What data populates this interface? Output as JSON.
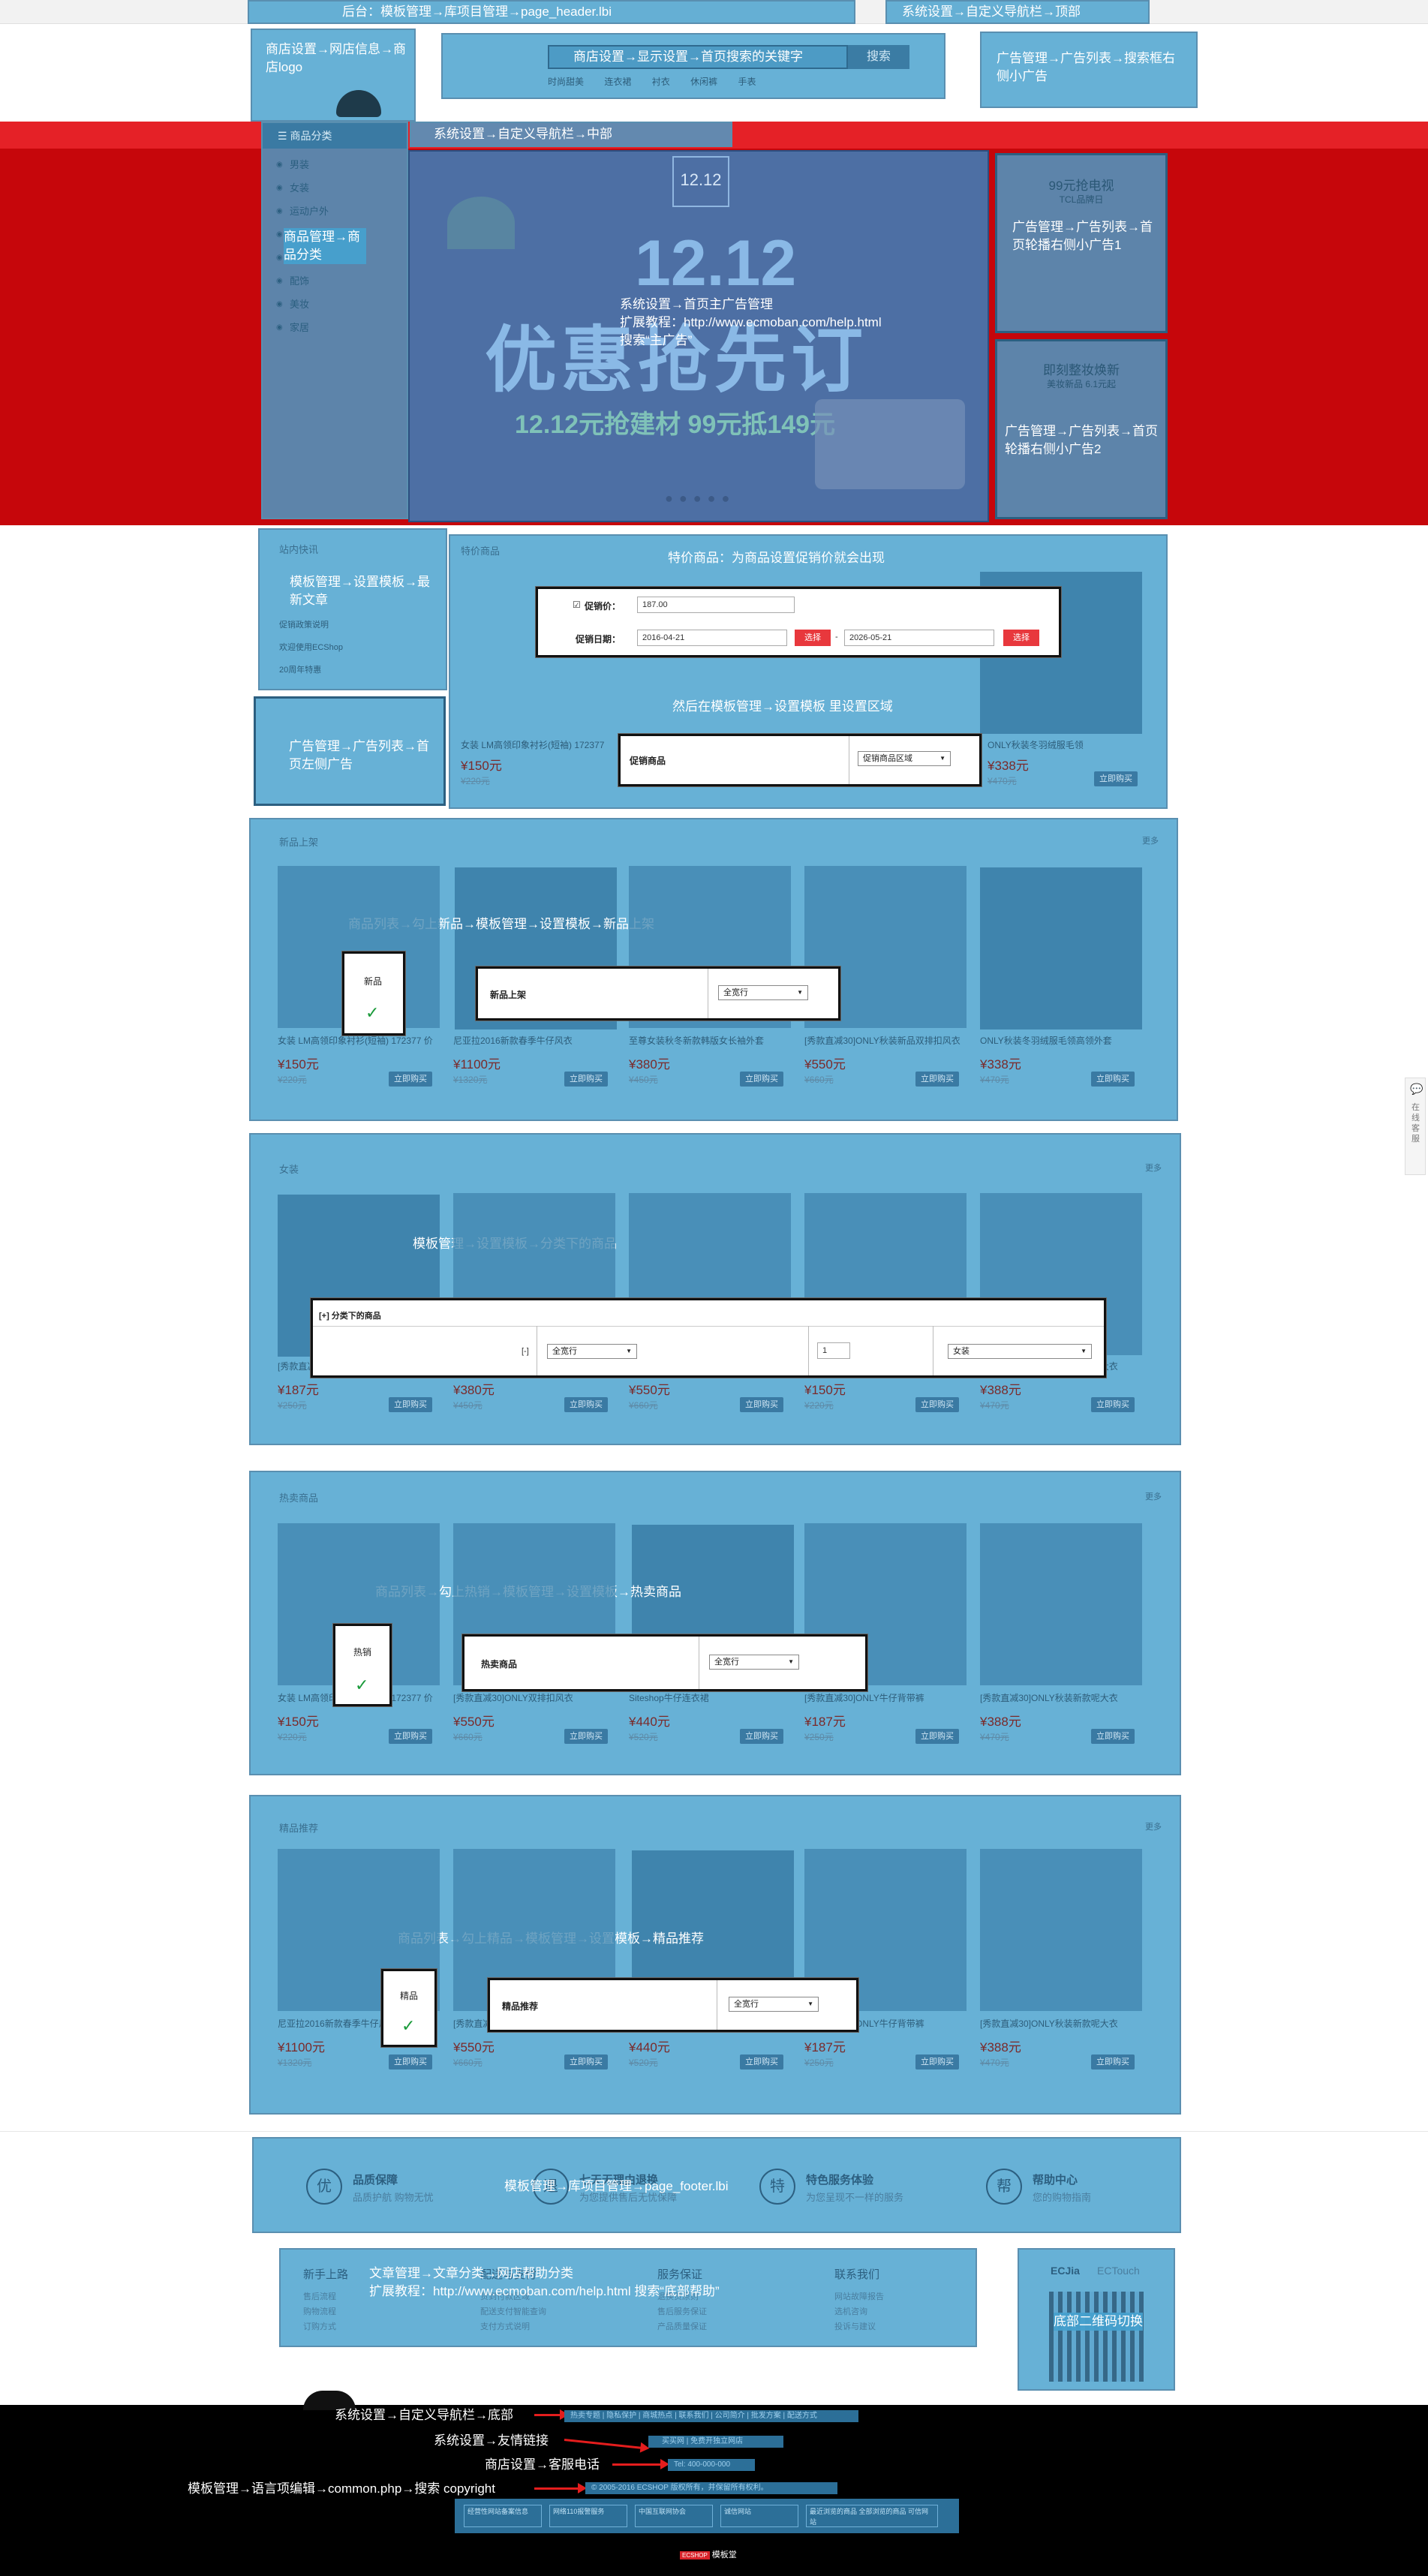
{
  "header": {
    "topbar_label": "后台：模板管理→库项目管理→page_header.lbi",
    "top_nav_label": "系统设置→自定义导航栏→顶部",
    "logo_label": "商店设置→网店信息→商店logo",
    "search_label": "商店设置→显示设置→首页搜索的关键字",
    "search_button": "搜索",
    "hot_keywords": [
      "时尚甜美",
      "连衣裙",
      "衬衣",
      "休闲裤",
      "手表"
    ],
    "search_ad_label": "广告管理→广告列表→搜索框右侧小广告",
    "middle_nav_label": "系统设置→自定义导航栏→中部"
  },
  "category": {
    "title": "商品分类",
    "items": [
      "男装",
      "女装",
      "运动户外",
      "",
      "箱包",
      "配饰",
      "美妆",
      "家居"
    ],
    "overlay_label": "商品管理→商品分类"
  },
  "main_banner": {
    "headline": "12.12",
    "big_text": "优惠抢先订",
    "sub_text": "12.12元抢建材 99元抵149元",
    "label_line1": "系统设置→首页主广告管理",
    "label_line2": "扩展教程：http://www.ecmoban.com/help.html",
    "label_line3": "搜索“主广告”"
  },
  "side_ads": {
    "ad1_title": "99元抢电视",
    "ad1_sub": "TCL品牌日",
    "ad1_label": "广告管理→广告列表→首页轮播右侧小广告1",
    "ad2_title": "即刻整妆焕新",
    "ad2_sub": "美妆新品 6.1元起",
    "ad2_label": "广告管理→广告列表→首页轮播右侧小广告2"
  },
  "news": {
    "title": "站内快讯",
    "overlay_label": "模板管理→设置模板→最新文章",
    "items": [
      "促销政策说明",
      "欢迎使用ECShop",
      "20周年特惠"
    ]
  },
  "left_ad_label": "广告管理→广告列表→首页左侧广告",
  "promo": {
    "title": "特价商品",
    "overlay_label": "特价商品：为商品设置促销价就会出现",
    "overlay_label2": "然后在模板管理→设置模板 里设置区域",
    "dialog_price_label": "促销价：",
    "dialog_price_value": "187.00",
    "dialog_date_label": "促销日期：",
    "dialog_date_start": "2016-04-21",
    "dialog_date_end": "2026-05-21",
    "dialog_pick": "选择",
    "dialog_region_label": "促销商品",
    "dialog_region_value": "促销商品区域",
    "products": [
      {
        "name": "女装 LM高领印象衬衫(短袖) 172377",
        "price": "¥150元",
        "old": "¥220元"
      },
      {
        "name": "ONLY秋装冬羽绒服毛领",
        "price": "¥338元",
        "old": "¥470元"
      }
    ]
  },
  "new_section": {
    "title": "新品上架",
    "more": "更多",
    "overlay_label": "商品列表→勾上新品→模板管理→设置模板→新品上架",
    "check_label": "新品",
    "dialog_label": "新品上架",
    "dialog_value": "全宽行",
    "products": [
      {
        "name": "女装 LM高领印象衬衫(短袖) 172377 价",
        "price": "¥150元",
        "old": "¥220元"
      },
      {
        "name": "尼亚拉2016新款春季牛仔风衣",
        "price": "¥1100元",
        "old": "¥1320元"
      },
      {
        "name": "至尊女装秋冬新款韩版女长袖外套",
        "price": "¥380元",
        "old": "¥450元"
      },
      {
        "name": "[秀款直减30]ONLY秋装新品双排扣风衣",
        "price": "¥550元",
        "old": "¥660元"
      },
      {
        "name": "ONLY秋装冬羽绒服毛领高领外套",
        "price": "¥338元",
        "old": "¥470元"
      }
    ]
  },
  "women_section": {
    "title": "女装",
    "more": "更多",
    "overlay_label": "模板管理→设置模板→分类下的商品",
    "dialog_label": "[+] 分类下的商品",
    "dialog_bracket": "[-]",
    "dialog_value": "全宽行",
    "dialog_num": "1",
    "dialog_cat": "女装",
    "products": [
      {
        "name": "[秀款直减]ONLY牛仔背带裤",
        "price": "¥187元",
        "old": "¥250元"
      },
      {
        "name": "至尊女装秋冬新款外套",
        "price": "¥380元",
        "old": "¥450元"
      },
      {
        "name": "[秀款直减30]ONLY双排扣风衣",
        "price": "¥550元",
        "old": "¥660元"
      },
      {
        "name": "女装 LM高领印象衬衫(短袖)",
        "price": "¥150元",
        "old": "¥220元"
      },
      {
        "name": "[秀款直减30]ONLY秋装新款呢大衣",
        "price": "¥388元",
        "old": "¥470元"
      }
    ]
  },
  "hot_section": {
    "title": "热卖商品",
    "more": "更多",
    "overlay_label": "商品列表→勾上热销→模板管理→设置模板→热卖商品",
    "check_label": "热销",
    "dialog_label": "热卖商品",
    "dialog_value": "全宽行",
    "products": [
      {
        "name": "女装 LM高领印象衬衫(短袖) 172377 价",
        "price": "¥150元",
        "old": "¥220元"
      },
      {
        "name": "[秀款直减30]ONLY双排扣风衣",
        "price": "¥550元",
        "old": "¥660元"
      },
      {
        "name": "Siteshop牛仔连衣裙",
        "price": "¥440元",
        "old": "¥520元"
      },
      {
        "name": "[秀款直减30]ONLY牛仔背带裤",
        "price": "¥187元",
        "old": "¥250元"
      },
      {
        "name": "[秀款直减30]ONLY秋装新款呢大衣",
        "price": "¥388元",
        "old": "¥470元"
      }
    ]
  },
  "best_section": {
    "title": "精品推荐",
    "more": "更多",
    "overlay_label": "商品列表→勾上精品→模板管理→设置模板→精品推荐",
    "check_label": "精品",
    "dialog_label": "精品推荐",
    "dialog_value": "全宽行",
    "products": [
      {
        "name": "尼亚拉2016新款春季牛仔风衣",
        "price": "¥1100元",
        "old": "¥1320元"
      },
      {
        "name": "[秀款直减30]ONLY双排扣风衣",
        "price": "¥550元",
        "old": "¥660元"
      },
      {
        "name": "Siteshop牛仔连衣裙",
        "price": "¥440元",
        "old": "¥520元"
      },
      {
        "name": "[秀款直减30]ONLY牛仔背带裤",
        "price": "¥187元",
        "old": "¥250元"
      },
      {
        "name": "[秀款直减30]ONLY秋装新款呢大衣",
        "price": "¥388元",
        "old": "¥470元"
      }
    ]
  },
  "services": {
    "overlay_label": "模板管理→库项目管理→page_footer.lbi",
    "items": [
      {
        "icon": "优",
        "title": "品质保障",
        "sub": "品质护航 购物无忧"
      },
      {
        "icon": "退",
        "title": "七天无理由退换",
        "sub": "为您提供售后无忧保障"
      },
      {
        "icon": "特",
        "title": "特色服务体验",
        "sub": "为您呈现不一样的服务"
      },
      {
        "icon": "帮",
        "title": "帮助中心",
        "sub": "您的购物指南"
      }
    ]
  },
  "help": {
    "columns": [
      {
        "title": "新手上路",
        "links": [
          "售后流程",
          "购物流程",
          "订购方式"
        ]
      },
      {
        "title": "配送与支付",
        "links": [
          "货到付款区域",
          "配送支付智能查询",
          "支付方式说明"
        ]
      },
      {
        "title": "服务保证",
        "links": [
          "退换货原则",
          "售后服务保证",
          "产品质量保证"
        ]
      },
      {
        "title": "联系我们",
        "links": [
          "网站故障报告",
          "选机咨询",
          "投诉与建议"
        ]
      }
    ],
    "label_line1": "文章管理→文章分类→网店帮助分类",
    "label_line2": "扩展教程：http://www.ecmoban.com/help.html 搜索“底部帮助”",
    "qr_tab1": "ECJia",
    "qr_tab2": "ECTouch",
    "qr_label": "底部二维码切换"
  },
  "bottom": {
    "nav_label": "系统设置→自定义导航栏→底部",
    "nav_links": "热卖专题 | 隐私保护 | 商城热点 | 联系我们 | 公司简介 | 批发方案 | 配送方式",
    "friend_label": "系统设置→友情链接",
    "friend_links": "买买网 | 免费开独立网店",
    "phone_label": "商店设置→客服电话",
    "phone_value": "Tel: 400-000-000",
    "copyright_label": "模板管理→语言项编辑→common.php→搜索 copyright",
    "copyright_value": "© 2005-2016 ECSHOP 版权所有，并保留所有权利。",
    "badges": [
      "经营性网站备案信息",
      "网络110报警服务",
      "中国互联网协会",
      "诚信网站",
      "最近浏览的商品 全部浏览的商品 可信网站"
    ],
    "powered": "模板堂",
    "powered_logo": "ECSHOP"
  },
  "side_service": "在线客服"
}
